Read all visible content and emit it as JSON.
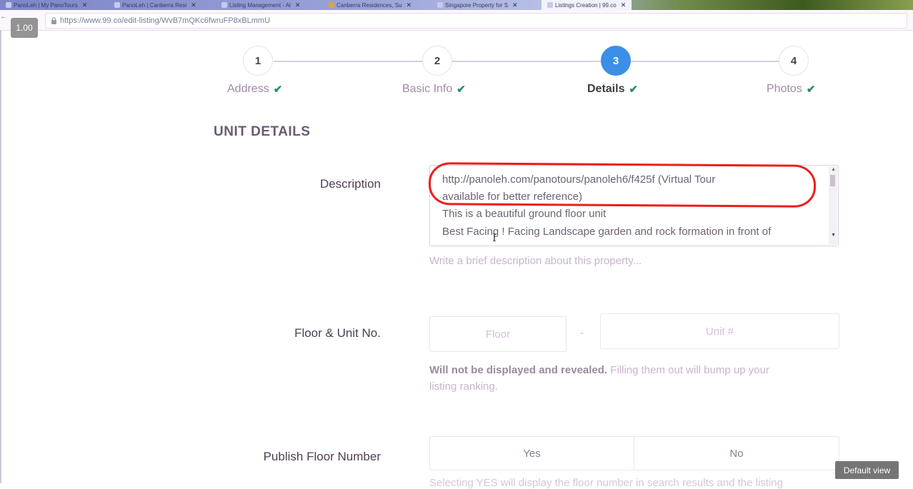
{
  "browser": {
    "tabs": [
      {
        "label": "PanoLeh | My PanoTours"
      },
      {
        "label": "PanoLeh | Canberra Resi"
      },
      {
        "label": "Listing Management - Al"
      },
      {
        "label": "Canberra Residences, Su"
      },
      {
        "label": "Singapore Property for S"
      },
      {
        "label": "Listings Creation | 99.co",
        "active": true
      }
    ],
    "url": "https://www.99.co/edit-listing/WvB7mQKc6fwruFP8xBLmmU",
    "zoom": "1.00"
  },
  "stepper": {
    "steps": [
      {
        "number": "1",
        "label": "Address",
        "done": true
      },
      {
        "number": "2",
        "label": "Basic Info",
        "done": true
      },
      {
        "number": "3",
        "label": "Details",
        "done": true,
        "active": true
      },
      {
        "number": "4",
        "label": "Photos",
        "done": true
      }
    ],
    "active_color": "#3b8fe6",
    "check_color": "#2d8a6c"
  },
  "form": {
    "section_title": "UNIT DETAILS",
    "description": {
      "label": "Description",
      "lines": [
        "http://panoleh.com/panotours/panoleh6/f425f   (Virtual Tour",
        "available for better reference)",
        "This is a beautiful ground floor unit",
        "Best Facing ! Facing Landscape garden and rock formation in front of"
      ],
      "helper": "Write a brief description about this property..."
    },
    "floor_unit": {
      "label": "Floor & Unit No.",
      "floor_placeholder": "Floor",
      "separator": "-",
      "unit_placeholder": "Unit #",
      "helper_bold": "Will not be displayed and revealed.",
      "helper_rest_line1": "Filling them out will bump up your",
      "helper_rest_line2": "listing ranking."
    },
    "publish_floor": {
      "label": "Publish Floor Number",
      "yes": "Yes",
      "no": "No",
      "helper_partial": "Selecting YES will display the floor number in search results and the listing"
    }
  },
  "overlay": {
    "default_view": "Default view",
    "annotation_color": "#ee1c1c"
  }
}
